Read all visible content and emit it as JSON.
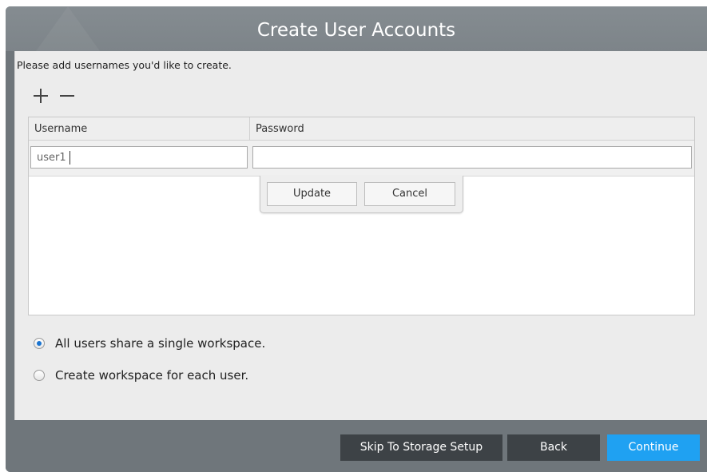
{
  "window": {
    "title": "Create User Accounts"
  },
  "content": {
    "instruction": "Please add usernames you'd like to create."
  },
  "toolbar": {
    "add_icon": "plus-icon",
    "remove_icon": "minus-icon"
  },
  "table": {
    "columns": [
      "Username",
      "Password"
    ],
    "editing_row": {
      "username_value": "user1",
      "password_value": ""
    }
  },
  "row_editor": {
    "update_label": "Update",
    "cancel_label": "Cancel"
  },
  "workspace_options": [
    {
      "label": "All users share a single workspace.",
      "selected": true
    },
    {
      "label": "Create workspace for each user.",
      "selected": false
    }
  ],
  "footer": {
    "skip_label": "Skip To Storage Setup",
    "back_label": "Back",
    "continue_label": "Continue"
  },
  "colors": {
    "chrome": "#6f767b",
    "panel": "#ececec",
    "dark_button": "#3d4246",
    "accent": "#1fa1f2",
    "radio_selected": "#1a74d0"
  }
}
